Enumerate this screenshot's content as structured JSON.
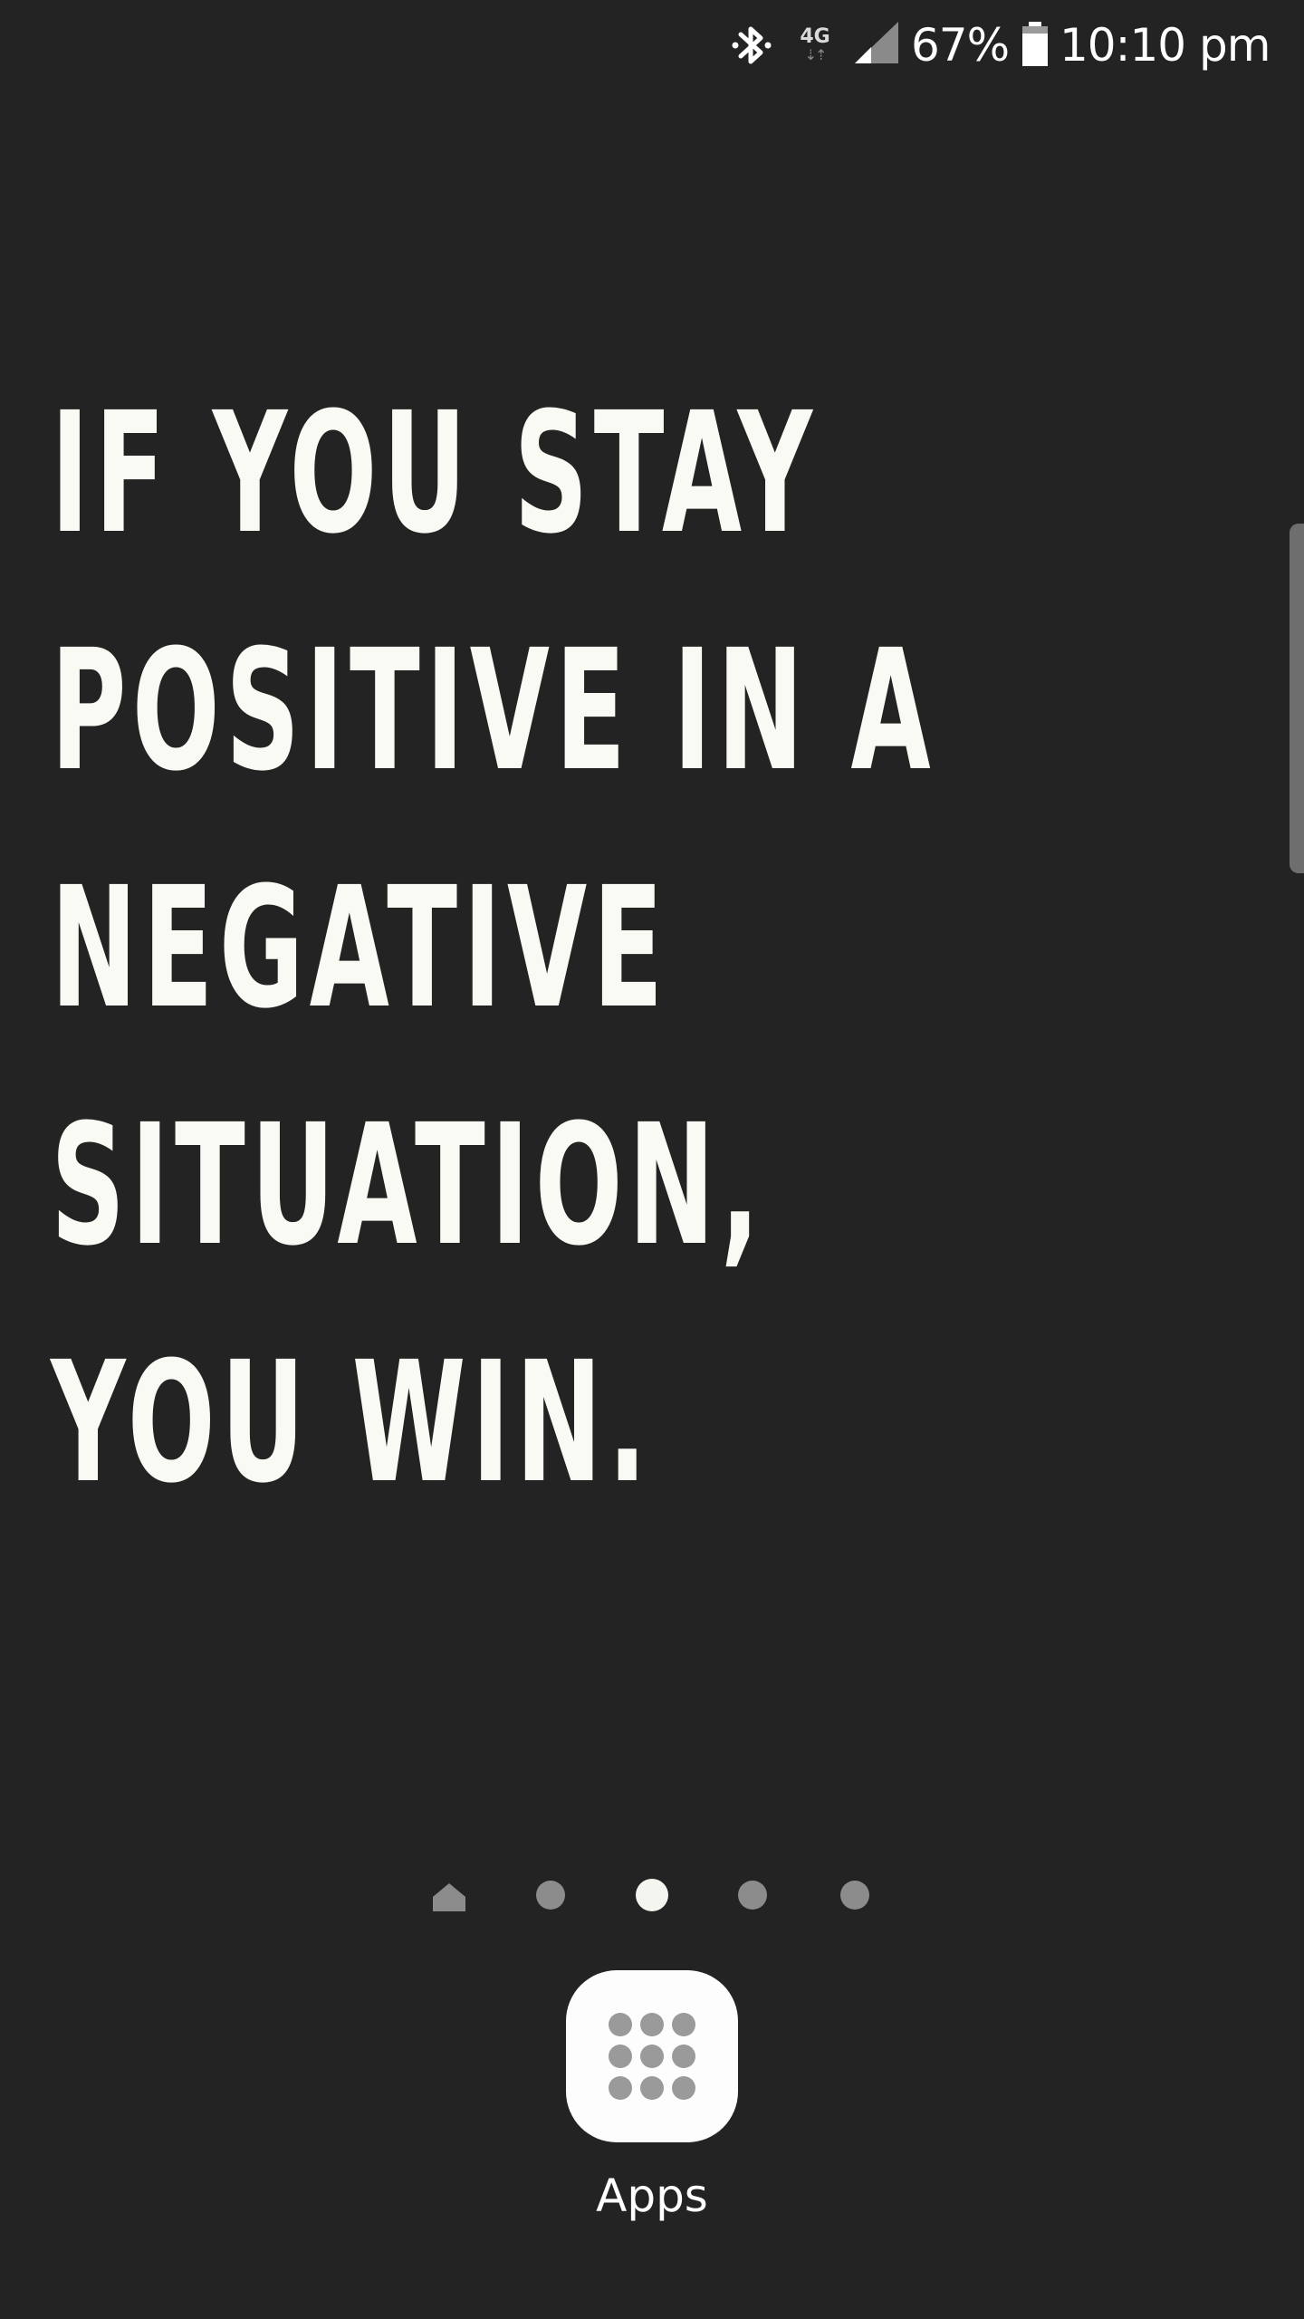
{
  "status_bar": {
    "bluetooth_icon": "bluetooth-icon",
    "network_type": "4G",
    "network_arrows": "⇣⇡",
    "signal_icon": "signal-bars-icon",
    "battery_percent": "67%",
    "battery_icon": "battery-icon",
    "time": "10:10 pm"
  },
  "wallpaper": {
    "quote_lines": [
      "IF YOU STAY",
      "POSITIVE IN A",
      "NEGATIVE",
      "SITUATION,",
      "YOU WIN."
    ],
    "text_color": "#fafaf4",
    "background_color": "#232323"
  },
  "page_indicator": {
    "pages": [
      {
        "type": "home"
      },
      {
        "type": "dot"
      },
      {
        "type": "dot",
        "active": true
      },
      {
        "type": "dot"
      },
      {
        "type": "dot"
      }
    ],
    "active_page": 2,
    "active_color": "#f5f5f0",
    "inactive_color": "#8c8c8c"
  },
  "apps_button": {
    "icon": "app-grid-icon",
    "label": "Apps"
  }
}
